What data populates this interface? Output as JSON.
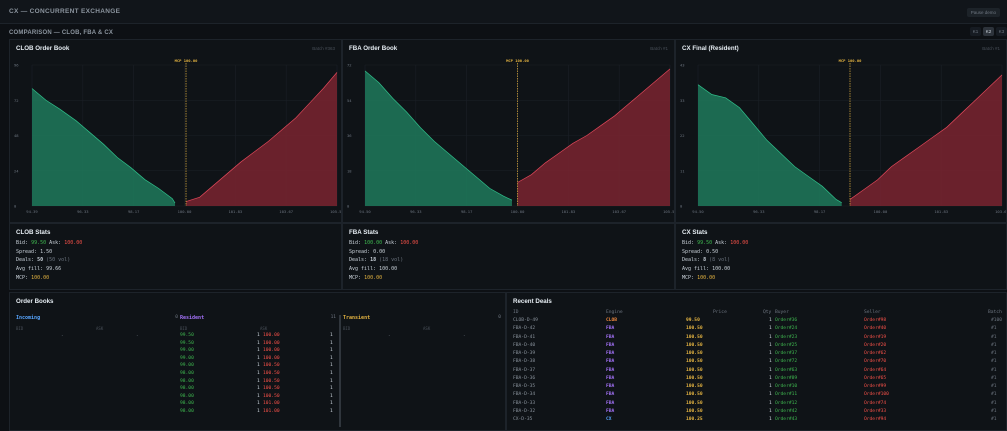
{
  "app": {
    "title": "CX — CONCURRENT EXCHANGE",
    "pause_label": "Pause demo"
  },
  "comparison": {
    "title": "COMPARISON — CLOB, FBA & CX",
    "tabs": [
      "K1",
      "K2",
      "K3"
    ],
    "active_tab": 1
  },
  "colors": {
    "bid": "#1f7a5c",
    "ask": "#7a2430",
    "bid_line": "#2fbf8a",
    "ask_line": "#e0485a",
    "mcp": "#e3b341"
  },
  "charts": [
    {
      "title": "CLOB Order Book",
      "meta": "Batch #363",
      "mcp_label": "MCP 100.00",
      "chart_data": {
        "type": "area",
        "y_ticks": [
          "0",
          "24",
          "48",
          "72",
          "96"
        ],
        "x_ticks": [
          "94.39",
          "96.33",
          "98.17",
          "100.00",
          "101.83",
          "103.67",
          "105.50"
        ],
        "xlim": [
          94.39,
          105.5
        ],
        "ylim": [
          0,
          96
        ],
        "mcp": 100.0,
        "bids": [
          [
            94.39,
            80
          ],
          [
            94.9,
            72
          ],
          [
            95.4,
            66
          ],
          [
            96.0,
            58
          ],
          [
            96.5,
            50
          ],
          [
            97.0,
            42
          ],
          [
            97.5,
            33
          ],
          [
            98.0,
            26
          ],
          [
            98.5,
            18
          ],
          [
            99.0,
            12
          ],
          [
            99.5,
            5
          ],
          [
            99.6,
            2
          ]
        ],
        "asks": [
          [
            100.0,
            3
          ],
          [
            100.5,
            6
          ],
          [
            101.0,
            14
          ],
          [
            101.5,
            22
          ],
          [
            102.0,
            30
          ],
          [
            102.5,
            37
          ],
          [
            103.0,
            44
          ],
          [
            103.5,
            52
          ],
          [
            104.0,
            60
          ],
          [
            104.5,
            70
          ],
          [
            105.0,
            80
          ],
          [
            105.5,
            91
          ]
        ]
      }
    },
    {
      "title": "FBA Order Book",
      "meta": "Batch #1",
      "mcp_label": "MCP 100.00",
      "chart_data": {
        "type": "area",
        "y_ticks": [
          "0",
          "18",
          "36",
          "54",
          "72"
        ],
        "x_ticks": [
          "94.50",
          "96.33",
          "98.17",
          "100.00",
          "101.83",
          "103.67",
          "105.50"
        ],
        "xlim": [
          94.5,
          105.5
        ],
        "ylim": [
          0,
          72
        ],
        "mcp": 100.0,
        "bids": [
          [
            94.5,
            69
          ],
          [
            95.0,
            63
          ],
          [
            95.5,
            55
          ],
          [
            96.0,
            48
          ],
          [
            96.5,
            40
          ],
          [
            97.0,
            33
          ],
          [
            97.5,
            27
          ],
          [
            98.0,
            21
          ],
          [
            98.5,
            15
          ],
          [
            99.0,
            9
          ],
          [
            99.5,
            5
          ],
          [
            99.8,
            3
          ]
        ],
        "asks": [
          [
            100.0,
            12
          ],
          [
            100.5,
            16
          ],
          [
            101.0,
            22
          ],
          [
            101.5,
            27
          ],
          [
            102.0,
            32
          ],
          [
            102.5,
            36
          ],
          [
            103.0,
            41
          ],
          [
            103.5,
            46
          ],
          [
            104.0,
            52
          ],
          [
            104.5,
            58
          ],
          [
            105.0,
            64
          ],
          [
            105.5,
            70
          ]
        ]
      }
    },
    {
      "title": "CX Final (Resident)",
      "meta": "Batch #1",
      "mcp_label": "MCP 100.00",
      "chart_data": {
        "type": "area",
        "y_ticks": [
          "0",
          "11",
          "22",
          "33",
          "43"
        ],
        "x_ticks": [
          "94.50",
          "96.33",
          "98.17",
          "100.00",
          "101.83",
          "103.67"
        ],
        "xlim": [
          94.5,
          105.5
        ],
        "ylim": [
          0,
          43
        ],
        "mcp": 100.0,
        "bids": [
          [
            94.5,
            37
          ],
          [
            95.0,
            34
          ],
          [
            95.5,
            33
          ],
          [
            96.0,
            30
          ],
          [
            96.5,
            25
          ],
          [
            97.0,
            20
          ],
          [
            97.5,
            16
          ],
          [
            98.0,
            12
          ],
          [
            98.5,
            9
          ],
          [
            99.0,
            6
          ],
          [
            99.5,
            2
          ],
          [
            99.7,
            1
          ]
        ],
        "asks": [
          [
            100.0,
            2
          ],
          [
            100.5,
            5
          ],
          [
            101.0,
            8
          ],
          [
            101.5,
            12
          ],
          [
            102.0,
            15
          ],
          [
            102.5,
            18
          ],
          [
            103.0,
            21
          ],
          [
            103.5,
            24
          ],
          [
            104.0,
            28
          ],
          [
            104.5,
            32
          ],
          [
            105.0,
            36
          ],
          [
            105.5,
            40
          ]
        ]
      }
    }
  ],
  "stats": [
    {
      "title": "CLOB Stats",
      "bid_label": "Bid:",
      "bid": "99.50",
      "ask_label": "Ask:",
      "ask": "100.00",
      "spread_label": "Spread:",
      "spread": "1.50",
      "deals_label": "Deals:",
      "deals": "50",
      "deals_vol": "(50 vol)",
      "fill_label": "Avg fill:",
      "fill": "99.66",
      "mcp_label": "MCP:",
      "mcp": "100.00"
    },
    {
      "title": "FBA Stats",
      "bid_label": "Bid:",
      "bid": "100.00",
      "ask_label": "Ask:",
      "ask": "100.00",
      "spread_label": "Spread:",
      "spread": "0.00",
      "deals_label": "Deals:",
      "deals": "18",
      "deals_vol": "(18 vol)",
      "fill_label": "Avg fill:",
      "fill": "100.00",
      "mcp_label": "MCP:",
      "mcp": "100.00"
    },
    {
      "title": "CX Stats",
      "bid_label": "Bid:",
      "bid": "99.50",
      "ask_label": "Ask:",
      "ask": "100.00",
      "spread_label": "Spread:",
      "spread": "0.50",
      "deals_label": "Deals:",
      "deals": "8",
      "deals_vol": "(8 vol)",
      "fill_label": "Avg fill:",
      "fill": "100.00",
      "mcp_label": "MCP:",
      "mcp": "100.00"
    }
  ],
  "order_books": {
    "title": "Order Books",
    "incoming": {
      "label": "Incoming",
      "count": "0",
      "bid_h": "BID",
      "ask_h": "ASK",
      "bid_empty": "-",
      "ask_empty": "-"
    },
    "resident": {
      "label": "Resident",
      "count": "11",
      "bid_h": "BID",
      "ask_h": "ASK",
      "rows": [
        [
          "99.50",
          "1",
          "100.00",
          "1"
        ],
        [
          "99.50",
          "1",
          "100.00",
          "1"
        ],
        [
          "99.00",
          "1",
          "100.00",
          "1"
        ],
        [
          "99.00",
          "1",
          "100.00",
          "1"
        ],
        [
          "99.00",
          "1",
          "100.50",
          "1"
        ],
        [
          "98.00",
          "1",
          "100.50",
          "1"
        ],
        [
          "98.00",
          "1",
          "100.50",
          "1"
        ],
        [
          "98.00",
          "1",
          "100.50",
          "1"
        ],
        [
          "98.00",
          "1",
          "100.50",
          "1"
        ],
        [
          "98.00",
          "1",
          "101.00",
          "1"
        ],
        [
          "98.00",
          "1",
          "101.00",
          "1"
        ]
      ]
    },
    "transient": {
      "label": "Transient",
      "count": "0",
      "bid_h": "BID",
      "ask_h": "ASK",
      "bid_empty": "-",
      "ask_empty": "-"
    }
  },
  "deals": {
    "title": "Recent Deals",
    "headers": [
      "ID",
      "Engine",
      "Price",
      "Qty",
      "Buyer",
      "Seller",
      "Batch"
    ],
    "rows": [
      [
        "CLOB-D-49",
        "CLOB",
        "99.50",
        "1",
        "Order#36",
        "Order#98",
        "#100"
      ],
      [
        "FBA-D-42",
        "FBA",
        "100.50",
        "1",
        "Order#24",
        "Order#40",
        "#1"
      ],
      [
        "FBA-D-41",
        "FBA",
        "100.50",
        "1",
        "Order#23",
        "Order#19",
        "#1"
      ],
      [
        "FBA-D-40",
        "FBA",
        "100.50",
        "1",
        "Order#25",
        "Order#20",
        "#1"
      ],
      [
        "FBA-D-39",
        "FBA",
        "100.50",
        "1",
        "Order#37",
        "Order#62",
        "#1"
      ],
      [
        "FBA-D-38",
        "FBA",
        "100.50",
        "1",
        "Order#72",
        "Order#70",
        "#1"
      ],
      [
        "FBA-D-37",
        "FBA",
        "100.50",
        "1",
        "Order#63",
        "Order#64",
        "#1"
      ],
      [
        "FBA-D-36",
        "FBA",
        "100.50",
        "1",
        "Order#89",
        "Order#65",
        "#1"
      ],
      [
        "FBA-D-35",
        "FBA",
        "100.50",
        "1",
        "Order#10",
        "Order#99",
        "#1"
      ],
      [
        "FBA-D-34",
        "FBA",
        "100.50",
        "1",
        "Order#11",
        "Order#100",
        "#1"
      ],
      [
        "FBA-D-33",
        "FBA",
        "100.50",
        "1",
        "Order#12",
        "Order#74",
        "#1"
      ],
      [
        "FBA-D-32",
        "FBA",
        "100.50",
        "1",
        "Order#42",
        "Order#33",
        "#1"
      ],
      [
        "CX-D-35",
        "CX",
        "100.25",
        "1",
        "Order#43",
        "Order#94",
        "#1"
      ]
    ]
  }
}
